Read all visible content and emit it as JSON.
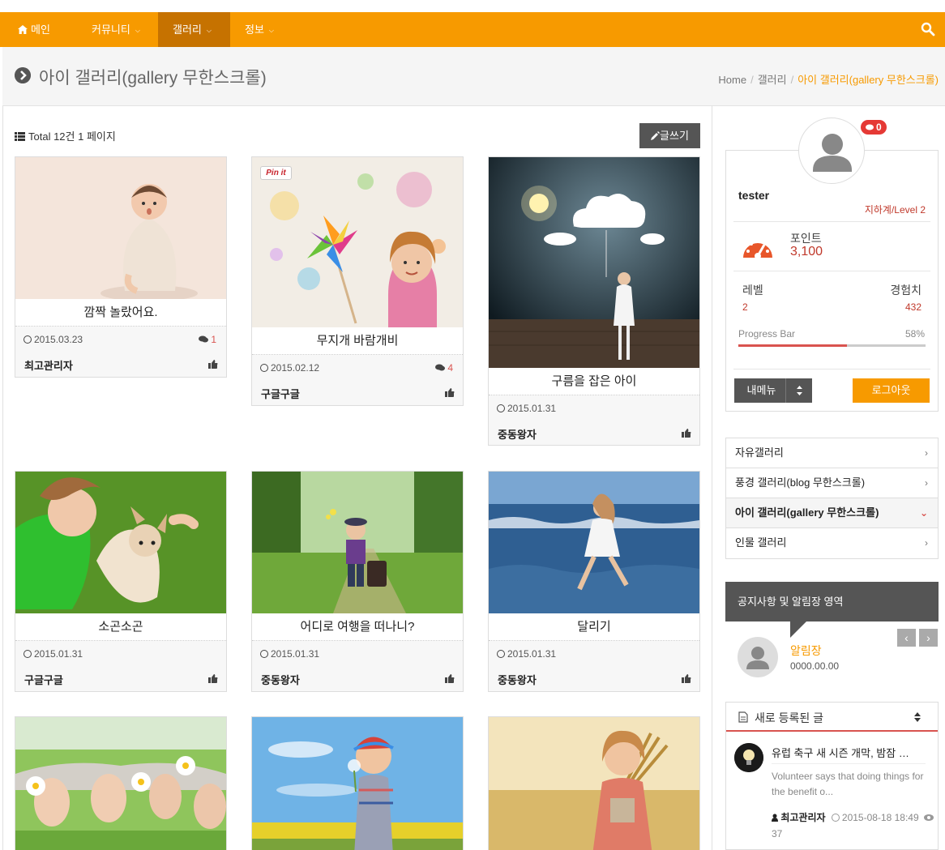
{
  "nav": {
    "items": [
      {
        "label": "메인",
        "icon": "home-icon"
      },
      {
        "label": "커뮤니티",
        "icon": "chevron-down-icon"
      },
      {
        "label": "갤러리",
        "icon": "chevron-down-icon"
      },
      {
        "label": "정보",
        "icon": "chevron-down-icon"
      }
    ],
    "accent": "#f79a00",
    "active_bg": "#c67200"
  },
  "header": {
    "title": "아이 갤러리(gallery 무한스크롤)",
    "breadcrumb": [
      "Home",
      "갤러리",
      "아이 갤러리(gallery 무한스크롤)"
    ]
  },
  "list": {
    "total": "Total 12건 1 페이지",
    "write_label": "글쓰기"
  },
  "cards": [
    {
      "caption": "깜짝 놀랐어요.",
      "date": "2015.03.23",
      "comments": "1",
      "author": "최고관리자"
    },
    {
      "caption": "무지개 바람개비",
      "date": "2015.02.12",
      "comments": "4",
      "author": "구글구글",
      "pin_label": "Pin it"
    },
    {
      "caption": "구름을 잡은 아이",
      "date": "2015.01.31",
      "comments": "",
      "author": "중동왕자"
    },
    {
      "caption": "소곤소곤",
      "date": "2015.01.31",
      "comments": "",
      "author": "구글구글"
    },
    {
      "caption": "어디로 여행을 떠나니?",
      "date": "2015.01.31",
      "comments": "",
      "author": "중동왕자"
    },
    {
      "caption": "달리기",
      "date": "2015.01.31",
      "comments": "",
      "author": "중동왕자"
    },
    {
      "caption": "",
      "date": "",
      "comments": "",
      "author": ""
    },
    {
      "caption": "",
      "date": "",
      "comments": "",
      "author": ""
    },
    {
      "caption": "",
      "date": "",
      "comments": "",
      "author": ""
    }
  ],
  "profile": {
    "badge": "0",
    "username": "tester",
    "level_name": "지하계/Level 2",
    "point_label": "포인트",
    "point_value": "3,100",
    "level_label": "레벨",
    "level_value": "2",
    "exp_label": "경험치",
    "exp_value": "432",
    "progress_label": "Progress Bar",
    "progress_pct": "58%",
    "progress": 0.58,
    "menu_label": "내메뉴",
    "logout_label": "로그아웃"
  },
  "categories": [
    {
      "label": "자유갤러리",
      "active": false
    },
    {
      "label": "풍경 갤러리(blog 무한스크롤)",
      "active": false
    },
    {
      "label": "아이 갤러리(gallery 무한스크롤)",
      "active": true
    },
    {
      "label": "인물 갤러리",
      "active": false
    }
  ],
  "notice": {
    "header": "공지사항 및 알림장 영역",
    "title": "알림장",
    "date": "0000.00.00"
  },
  "recent": {
    "header": "새로 등록된 글",
    "title": "유럽 축구 새 시즌 개막, 밤잠 …",
    "desc": "Volunteer says that doing things for the benefit o...",
    "author": "최고관리자",
    "date": "2015-08-18 18:49",
    "views": "37"
  }
}
